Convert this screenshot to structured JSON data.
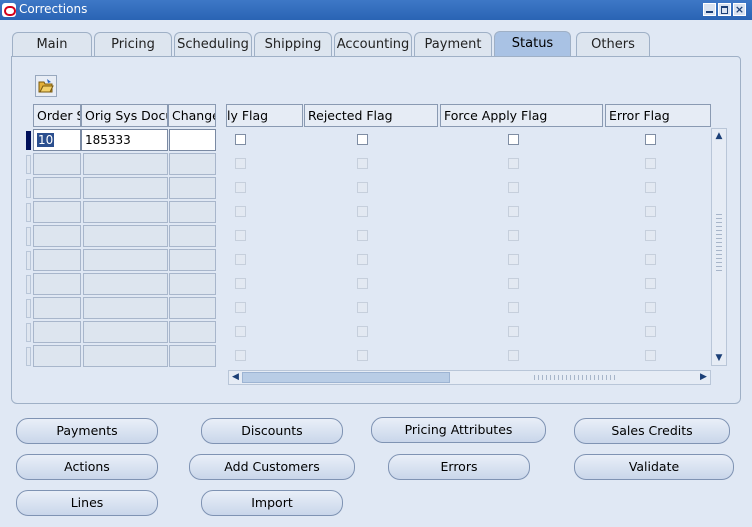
{
  "window": {
    "title": "Corrections"
  },
  "tabs": [
    {
      "label": "Main"
    },
    {
      "label": "Pricing"
    },
    {
      "label": "Scheduling"
    },
    {
      "label": "Shipping"
    },
    {
      "label": "Accounting"
    },
    {
      "label": "Payment"
    },
    {
      "label": "Status"
    },
    {
      "label": "Others"
    }
  ],
  "active_tab": "Status",
  "icons": {
    "open": "open-folder-icon",
    "scroll_up": "arrow-up-icon",
    "scroll_down": "arrow-down-icon",
    "scroll_left": "arrow-left-icon",
    "scroll_right": "arrow-right-icon"
  },
  "grid": {
    "headers": {
      "order_source": "Order S",
      "orig_sys_doc": "Orig Sys Docu",
      "change": "Change",
      "ready_flag": "ly Flag",
      "rejected_flag": "Rejected Flag",
      "force_apply_flag": "Force Apply Flag",
      "error_flag": "Error Flag"
    },
    "first_row": {
      "order_source": "10",
      "orig_sys_doc": "185333",
      "change": ""
    }
  },
  "buttons": {
    "payments": "Payments",
    "discounts": "Discounts",
    "pricing_attributes": "Pricing Attributes",
    "sales_credits": "Sales Credits",
    "actions": "Actions",
    "add_customers": "Add Customers",
    "errors": "Errors",
    "validate": "Validate",
    "lines": "Lines",
    "import": "Import"
  },
  "colors": {
    "title_bar": "#2a64b4",
    "active_tab": "#a9c2e4",
    "background": "#e0e8f4"
  }
}
